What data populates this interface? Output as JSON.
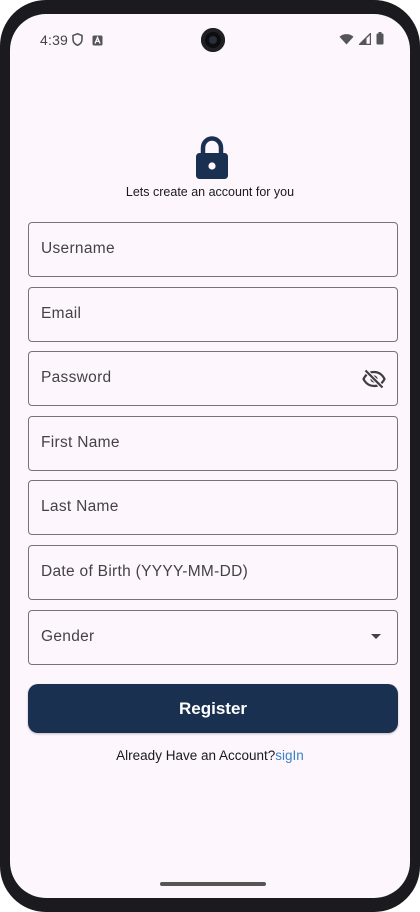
{
  "status_bar": {
    "time": "4:39",
    "left_icons": [
      "shield-icon",
      "a-badge-icon"
    ],
    "right_icons": [
      "wifi-icon",
      "signal-icon",
      "battery-icon"
    ]
  },
  "header": {
    "icon": "lock-icon",
    "subtitle": "Lets create an account for you"
  },
  "form": {
    "username": {
      "label": "Username"
    },
    "email": {
      "label": "Email"
    },
    "password": {
      "label": "Password",
      "trailing_icon": "visibility-off-icon"
    },
    "first_name": {
      "label": "First Name"
    },
    "last_name": {
      "label": "Last Name"
    },
    "dob": {
      "label": "Date of Birth (YYYY-MM-DD)"
    },
    "gender": {
      "label": "Gender",
      "trailing_icon": "arrow-drop-down-icon"
    }
  },
  "register_button": {
    "label": "Register"
  },
  "signin": {
    "prompt": "Already Have an Account?",
    "link": "sigIn"
  },
  "colors": {
    "background": "#fdf7fd",
    "primary": "#1a3050",
    "link": "#3b82c4",
    "outline": "#76737c"
  }
}
